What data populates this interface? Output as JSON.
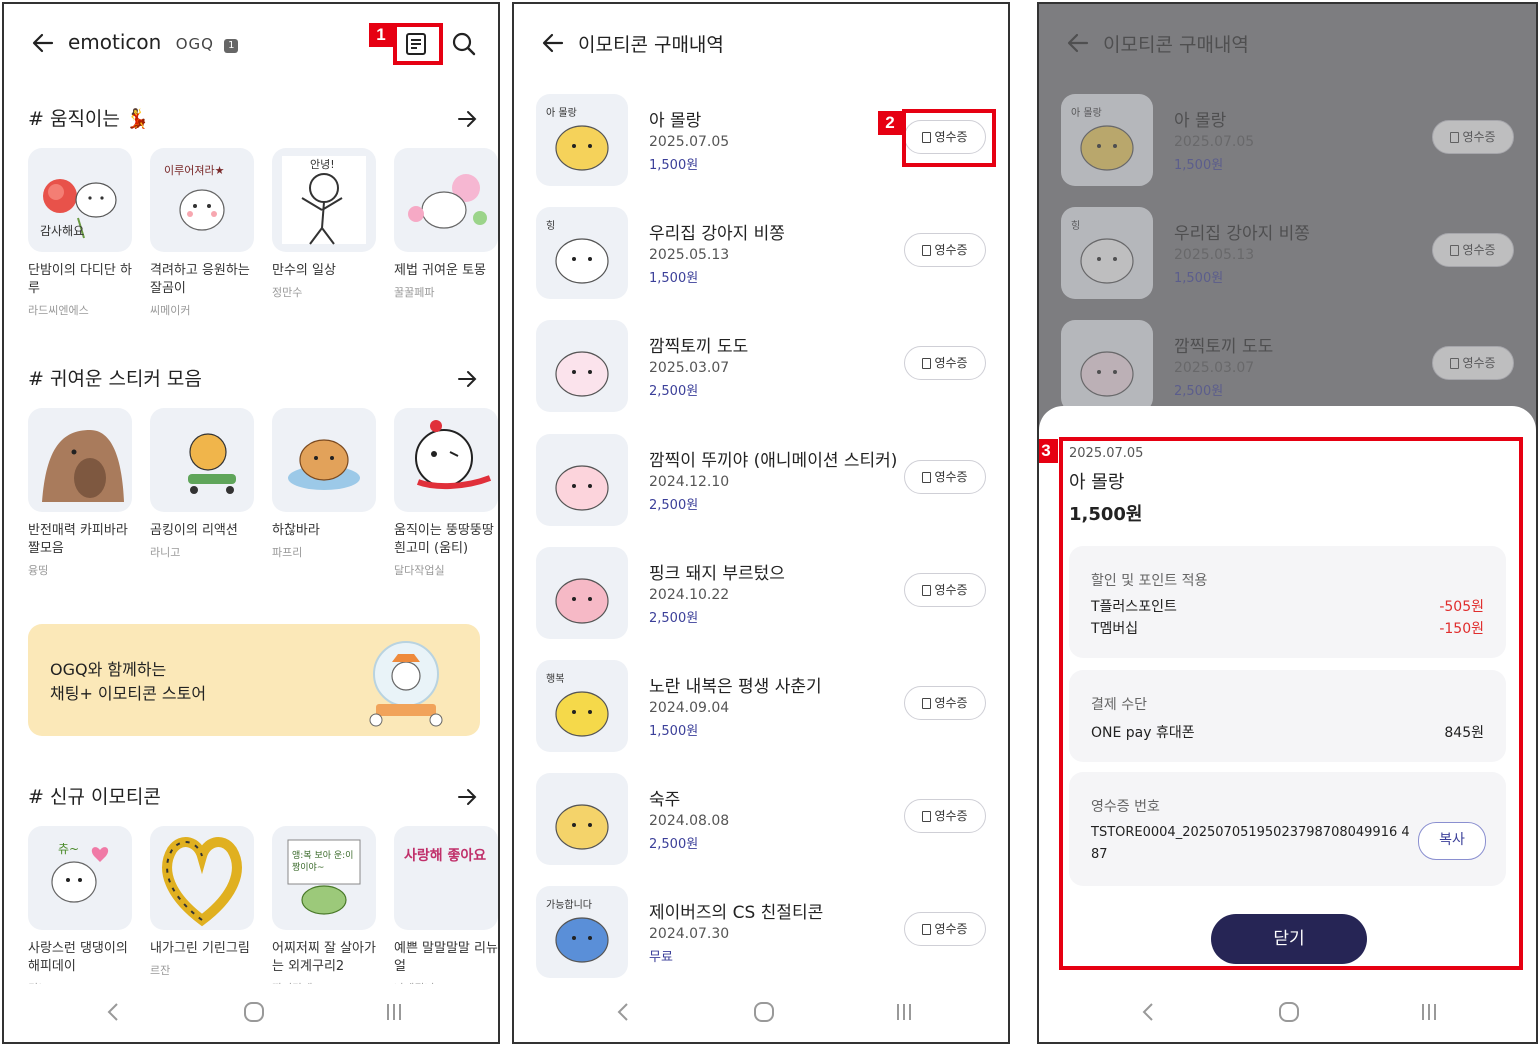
{
  "panel1": {
    "title": "emoticon",
    "brand": "OGQ",
    "brand_num": "1",
    "sections": [
      {
        "title": "# 움직이는 💃",
        "cards": [
          {
            "name": "단밤이의 다디단 하루",
            "author": "라드씨엔에스",
            "thumb_text": "감사해요"
          },
          {
            "name": "격려하고 응원하는 잘곰이",
            "author": "씨메이커",
            "thumb_text": "이루어져라★"
          },
          {
            "name": "만수의 일상",
            "author": "정만수",
            "thumb_text": "안녕!"
          },
          {
            "name": "제법 귀여운 토몽",
            "author": "꿀꿀페파",
            "thumb_text": ""
          }
        ]
      },
      {
        "title": "# 귀여운 스티커 모음",
        "cards": [
          {
            "name": "반전매력 카피바라 짤모음",
            "author": "융띵",
            "thumb_text": ""
          },
          {
            "name": "곰킹이의 리액션",
            "author": "라니고",
            "thumb_text": ""
          },
          {
            "name": "하찮바라",
            "author": "파프리",
            "thumb_text": ""
          },
          {
            "name": "움직이는 뚱땅뚱땅 흰고미 (움티)",
            "author": "달다작업실",
            "thumb_text": ""
          }
        ]
      },
      {
        "title": "# 신규 이모티콘",
        "cards": [
          {
            "name": "사랑스런 댕댕이의 해피데이",
            "author": "킨노",
            "thumb_text": "츄~"
          },
          {
            "name": "내가그린 기린그림",
            "author": "르잔",
            "thumb_text": ""
          },
          {
            "name": "어찌저찌 잘 살아가는 외계구리2",
            "author": "깐지라네",
            "thumb_text": "앵:복 보아 운:이 짱이야~"
          },
          {
            "name": "예쁜 말말말말 리뉴얼",
            "author": "나메뭐니",
            "thumb_text": "사랑해 좋아요"
          }
        ]
      }
    ],
    "banner": {
      "line1": "OGQ와 함께하는",
      "line2": "채팅+ 이모티콘 스토어"
    }
  },
  "panel2": {
    "title": "이모티콘 구매내역",
    "receipt_label": "영수증",
    "items": [
      {
        "name": "아 몰랑",
        "date": "2025.07.05",
        "price": "1,500원",
        "thumb_text": "아 몰랑"
      },
      {
        "name": "우리집 강아지 비쫑",
        "date": "2025.05.13",
        "price": "1,500원",
        "thumb_text": "힝"
      },
      {
        "name": "깜찍토끼 도도",
        "date": "2025.03.07",
        "price": "2,500원",
        "thumb_text": ""
      },
      {
        "name": "깜찍이 뚜끼야 (애니메이션 스티커)",
        "date": "2024.12.10",
        "price": "2,500원",
        "thumb_text": ""
      },
      {
        "name": "핑크 돼지 부르텄으",
        "date": "2024.10.22",
        "price": "2,500원",
        "thumb_text": ""
      },
      {
        "name": "노란 내복은 평생 사춘기",
        "date": "2024.09.04",
        "price": "1,500원",
        "thumb_text": "행복"
      },
      {
        "name": "숙주",
        "date": "2024.08.08",
        "price": "2,500원",
        "thumb_text": ""
      },
      {
        "name": "제이버즈의 CS 친절티콘",
        "date": "2024.07.30",
        "price": "무료",
        "thumb_text": "가능합니다"
      }
    ]
  },
  "panel3": {
    "title": "이모티콘 구매내역",
    "receipt_label": "영수증",
    "items": [
      {
        "name": "아 몰랑",
        "date": "2025.07.05",
        "price": "1,500원",
        "thumb_text": "아 몰랑"
      },
      {
        "name": "우리집 강아지 비쫑",
        "date": "2025.05.13",
        "price": "1,500원",
        "thumb_text": "힝"
      },
      {
        "name": "깜찍토끼 도도",
        "date": "2025.03.07",
        "price": "2,500원",
        "thumb_text": ""
      }
    ],
    "sheet": {
      "date": "2025.07.05",
      "name": "아 몰랑",
      "price": "1,500원",
      "discount_title": "할인 및 포인트 적용",
      "discounts": [
        {
          "label": "T플러스포인트",
          "value": "-505원"
        },
        {
          "label": "T멤버십",
          "value": "-150원"
        }
      ],
      "payment_title": "결제 수단",
      "payment_method": "ONE pay 휴대폰",
      "payment_amount": "845원",
      "receipt_no_title": "영수증 번호",
      "receipt_no_line1": "TSTORE0004_20250705195023798708049916 4",
      "receipt_no_line2": "87",
      "copy_label": "복사",
      "close_label": "닫기"
    }
  },
  "annotations": [
    "1",
    "2",
    "3"
  ],
  "colors": {
    "highlight": "#e60012",
    "accent": "#3b3f99",
    "close_button": "#262555",
    "negative": "#e02d2d",
    "banner": "#fbe8b8"
  }
}
